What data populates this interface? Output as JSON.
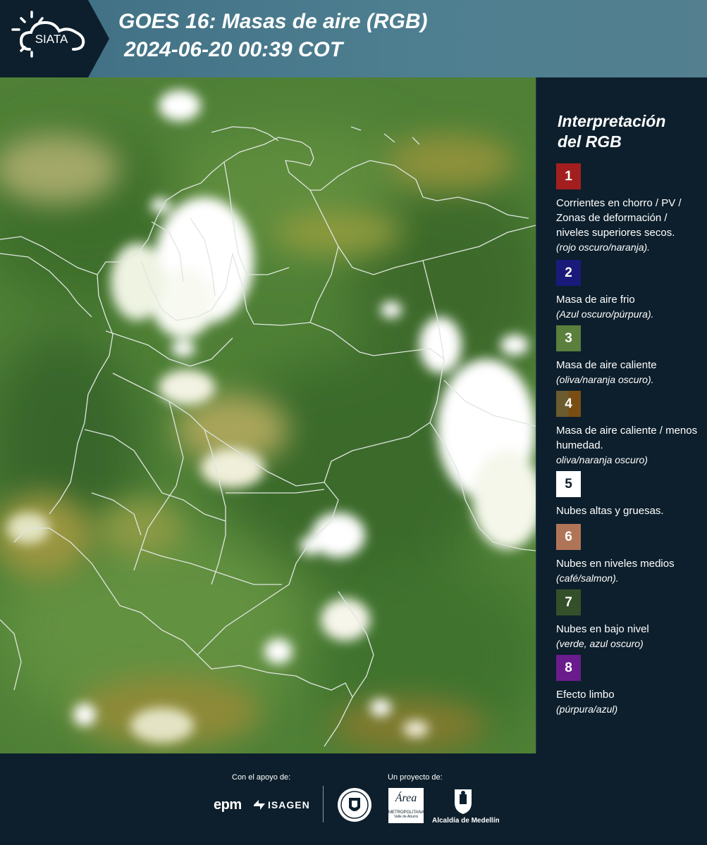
{
  "header": {
    "logo_text": "SIATA",
    "title_line1": "GOES 16: Masas de aire (RGB)",
    "title_line2": "2024-06-20 00:39 COT"
  },
  "legend": {
    "title_line1": "Interpretación",
    "title_line2": "del RGB",
    "items": [
      {
        "number": "1",
        "color": "#a31f1f",
        "text": "Corrientes en chorro / PV / Zonas de deformación / niveles superiores secos.",
        "note": "(rojo oscuro/naranja)."
      },
      {
        "number": "2",
        "color": "#1a1a7a",
        "text": "Masa de aire frio",
        "note": "(Azul oscuro/púrpura)."
      },
      {
        "number": "3",
        "color": "#5b7f3c",
        "text": "Masa de aire caliente",
        "note": "(oliva/naranja oscuro)."
      },
      {
        "number": "4",
        "color": "#6b5b2e",
        "color2": "#7a4e12",
        "text": "Masa de aire caliente / menos humedad.",
        "note": "oliva/naranja oscuro)"
      },
      {
        "number": "5",
        "color": "#ffffff",
        "text": "Nubes altas y gruesas.",
        "note": ""
      },
      {
        "number": "6",
        "color": "#b07557",
        "text": "Nubes en niveles medios",
        "note": "(café/salmon)."
      },
      {
        "number": "7",
        "color": "#34502a",
        "text": "Nubes en bajo nivel",
        "note": "(verde, azul oscuro)"
      },
      {
        "number": "8",
        "color": "#6b1c8c",
        "text": "Efecto limbo",
        "note": "(púrpura/azul)"
      }
    ]
  },
  "footer": {
    "support_label": "Con el apoyo de:",
    "project_label": "Un proyecto de:",
    "sponsor1": "epm",
    "sponsor2": "ISAGEN",
    "partner_metro_title": "Área",
    "partner_metro_sub": "METROPOLITANA",
    "partner_metro_sub2": "Valle de Aburrá",
    "partner_alcaldia": "Alcaldía de Medellín"
  }
}
